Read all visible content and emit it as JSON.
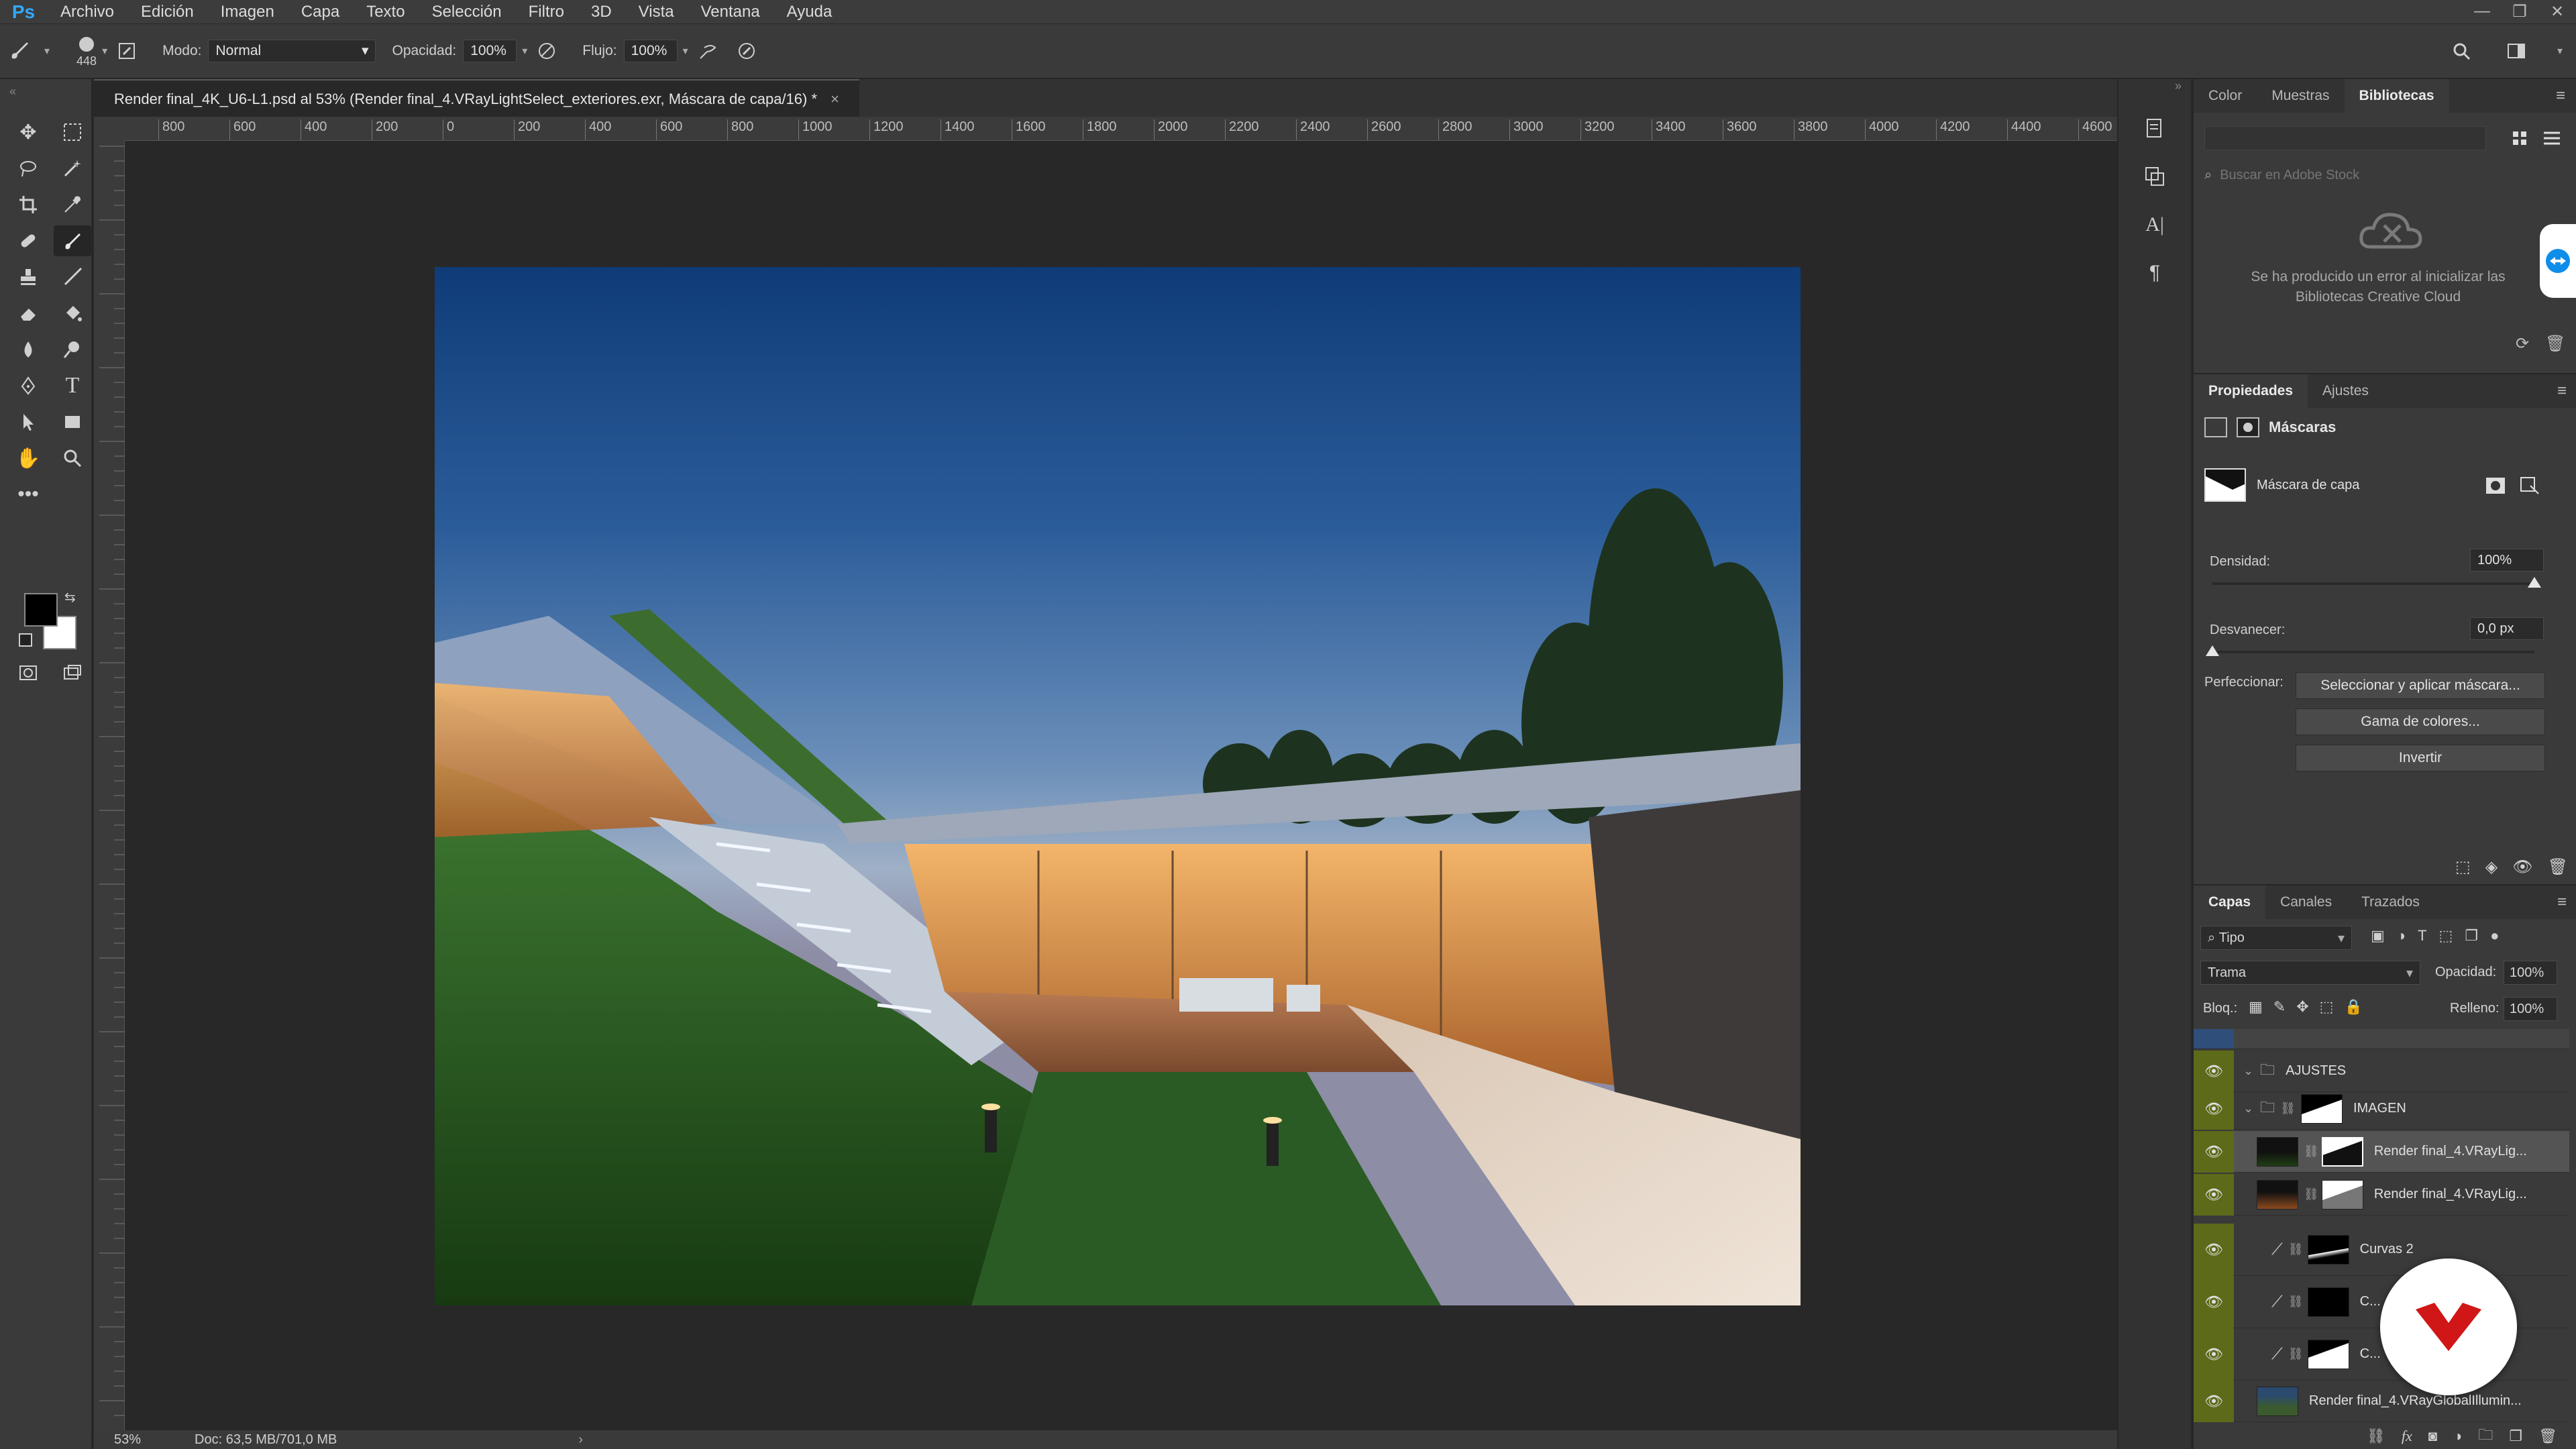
{
  "menubar": {
    "logo": "Ps",
    "items": [
      "Archivo",
      "Edición",
      "Imagen",
      "Capa",
      "Texto",
      "Selección",
      "Filtro",
      "3D",
      "Vista",
      "Ventana",
      "Ayuda"
    ]
  },
  "options": {
    "brush_size": "448",
    "mode_label": "Modo:",
    "mode_value": "Normal",
    "opacity_label": "Opacidad:",
    "opacity_value": "100%",
    "flow_label": "Flujo:",
    "flow_value": "100%"
  },
  "document": {
    "tab_title": "Render final_4K_U6-L1.psd al 53% (Render final_4.VRayLightSelect_exteriores.exr, Máscara de capa/16) *",
    "close": "×",
    "ruler_ticks": [
      "800",
      "600",
      "400",
      "200",
      "0",
      "200",
      "400",
      "600",
      "800",
      "1000",
      "1200",
      "1400",
      "1600",
      "1800",
      "2000",
      "2200",
      "2400",
      "2600",
      "2800",
      "3000",
      "3200",
      "3400",
      "3600",
      "3800",
      "4000",
      "4200",
      "4400",
      "4600"
    ]
  },
  "status": {
    "zoom": "53%",
    "doc": "Doc: 63,5 MB/701,0 MB"
  },
  "libraries_panel": {
    "tabs": [
      "Color",
      "Muestras",
      "Bibliotecas"
    ],
    "active_tab": "Bibliotecas",
    "search_placeholder": "Buscar en Adobe Stock",
    "error_line1": "Se ha producido un error al inicializar las",
    "error_line2": "Bibliotecas Creative Cloud"
  },
  "properties_panel": {
    "tabs": [
      "Propiedades",
      "Ajustes"
    ],
    "active_tab": "Propiedades",
    "section": "Máscaras",
    "mask_label": "Máscara de capa",
    "density_label": "Densidad:",
    "density_value": "100%",
    "density_level": 1.0,
    "feather_label": "Desvanecer:",
    "feather_value": "0,0 px",
    "feather_level": 0.0,
    "refine_label": "Perfeccionar:",
    "btn_select_mask": "Seleccionar y aplicar máscara...",
    "btn_color_range": "Gama de colores...",
    "btn_invert": "Invertir"
  },
  "layers_panel": {
    "tabs": [
      "Capas",
      "Canales",
      "Trazados"
    ],
    "active_tab": "Capas",
    "filter_value": "Tipo",
    "blend_value": "Trama",
    "opacity_label": "Opacidad:",
    "opacity_value": "100%",
    "lock_label": "Bloq.:",
    "fill_label": "Relleno:",
    "fill_value": "100%",
    "layers": [
      {
        "name": "AJUSTES",
        "kind": "group"
      },
      {
        "name": "IMAGEN",
        "kind": "group"
      },
      {
        "name": "Render final_4.VRayLig...",
        "kind": "layer",
        "selected": true
      },
      {
        "name": "Render final_4.VRayLig...",
        "kind": "layer"
      },
      {
        "name": "Curvas 2",
        "kind": "adjust"
      },
      {
        "name": "C...",
        "kind": "adjust"
      },
      {
        "name": "C...",
        "kind": "adjust"
      },
      {
        "name": "Render final_4.VRayGlobalIllumin...",
        "kind": "layer"
      }
    ]
  }
}
